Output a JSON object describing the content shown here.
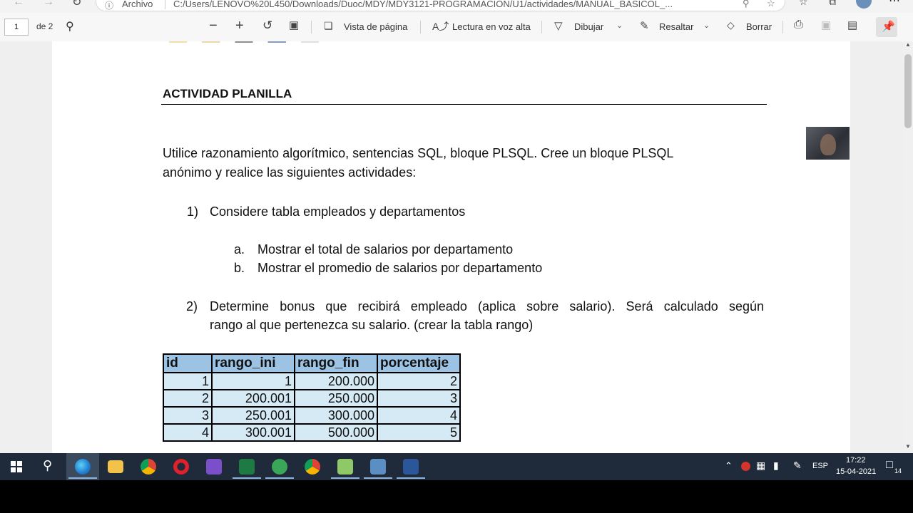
{
  "browser": {
    "site_label": "Archivo",
    "address": "C:/Users/LENOVO%20L450/Downloads/Duoc/MDY/MDY3121-PROGRAMACION/U1/actividades/MANUAL_BASICOL_..."
  },
  "toolbar": {
    "page_number": "1",
    "page_total": "de 2",
    "page_view_label": "Vista de página",
    "read_aloud_label": "Lectura en voz alta",
    "draw_label": "Dibujar",
    "highlight_label": "Resaltar",
    "erase_label": "Borrar"
  },
  "document": {
    "heading": "ACTIVIDAD PLANILLA",
    "intro_line1": "Utilice razonamiento algorítmico, sentencias SQL, bloque PLSQL. Cree un bloque PLSQL",
    "intro_line2": "anónimo y realice las siguientes actividades:",
    "item1_num": "1)",
    "item1_text": "Considere tabla empleados y departamentos",
    "sub_a_letter": "a.",
    "sub_a_text": "Mostrar el total de salarios por departamento",
    "sub_b_letter": "b.",
    "sub_b_text": "Mostrar el promedio de salarios por departamento",
    "item2_num": "2)",
    "item2_line1": "Determine bonus que recibirá empleado (aplica sobre salario). Será calculado según",
    "item2_line2": "rango al que pertenezca su salario. (crear la tabla rango)",
    "table": {
      "headers": [
        "id",
        "rango_ini",
        "rango_fin",
        "porcentaje"
      ],
      "rows": [
        [
          "1",
          "1",
          "200.000",
          "2"
        ],
        [
          "2",
          "200.001",
          "250.000",
          "3"
        ],
        [
          "3",
          "250.001",
          "300.000",
          "4"
        ],
        [
          "4",
          "300.001",
          "500.000",
          "5"
        ]
      ]
    }
  },
  "taskbar": {
    "language": "ESP",
    "time": "17:22",
    "date": "15-04-2021",
    "notification_count": "14"
  },
  "colors": {
    "table_header": "#9cc3e4",
    "table_cell": "#d6eaf5",
    "taskbar": "#1f2b3a"
  }
}
